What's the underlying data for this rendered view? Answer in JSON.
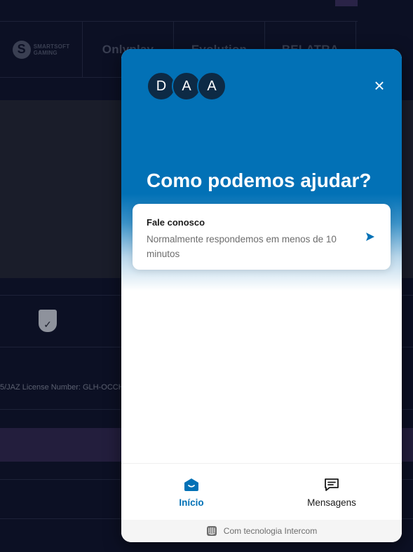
{
  "background": {
    "providers": [
      {
        "name": "SMARTSOFT GAMING",
        "line1": "SMARTSOFT",
        "line2": "GAMING"
      },
      {
        "name": "Onlyplay"
      },
      {
        "name": "Evolution"
      },
      {
        "name": "BELATRA"
      }
    ],
    "license_text": "5/JAZ License Number: GLH-OCCH"
  },
  "widget": {
    "avatars": [
      "D",
      "A",
      "A"
    ],
    "headline": "Como podemos ajudar?",
    "contact_card": {
      "title": "Fale conosco",
      "subtitle": "Normalmente respondemos em menos de 10 minutos"
    },
    "nav": {
      "home_label": "Início",
      "messages_label": "Mensagens",
      "active": "home"
    },
    "footer_text": "Com tecnologia Intercom"
  },
  "colors": {
    "brand": "#0271b6",
    "page_bg": "#0c1024"
  },
  "icons": {
    "close": "close-icon",
    "send": "send-arrow-icon",
    "home": "home-icon",
    "messages": "messages-icon",
    "intercom": "intercom-logo-icon"
  }
}
